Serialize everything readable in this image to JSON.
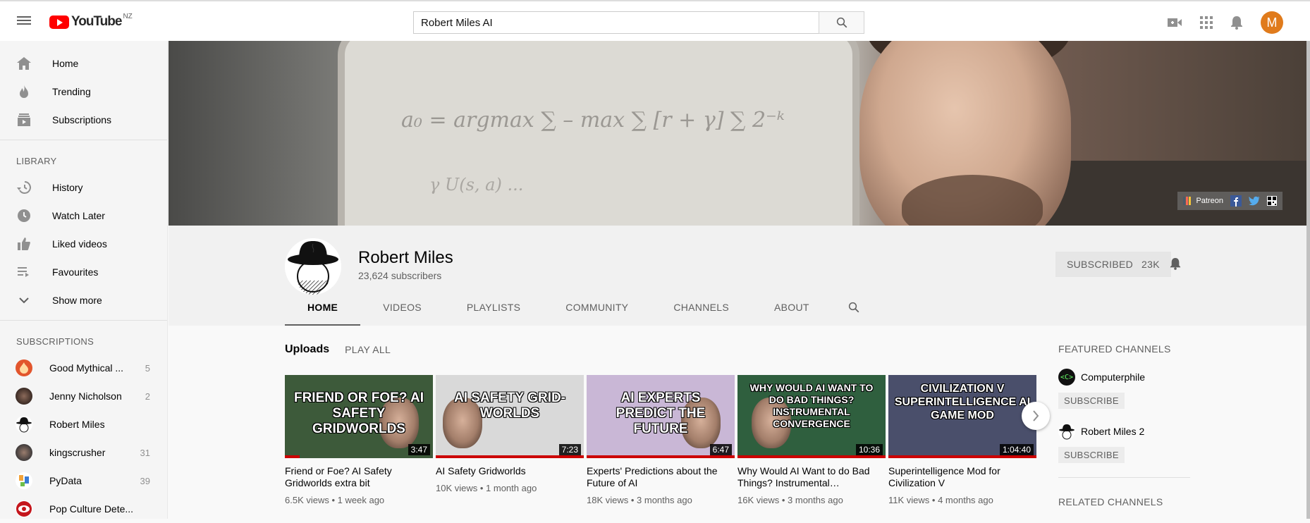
{
  "header": {
    "logo_text": "YouTube",
    "country_code": "NZ",
    "search_value": "Robert Miles AI",
    "avatar_letter": "M"
  },
  "sidebar": {
    "main": [
      {
        "label": "Home",
        "icon": "home-icon"
      },
      {
        "label": "Trending",
        "icon": "trending-icon"
      },
      {
        "label": "Subscriptions",
        "icon": "subscriptions-icon"
      }
    ],
    "library_title": "LIBRARY",
    "library": [
      {
        "label": "History",
        "icon": "history-icon"
      },
      {
        "label": "Watch Later",
        "icon": "clock-icon"
      },
      {
        "label": "Liked videos",
        "icon": "thumbs-up-icon"
      },
      {
        "label": "Favourites",
        "icon": "playlist-icon"
      },
      {
        "label": "Show more",
        "icon": "chevron-down-icon"
      }
    ],
    "subscriptions_title": "SUBSCRIPTIONS",
    "subscriptions": [
      {
        "name": "Good Mythical ...",
        "count": "5"
      },
      {
        "name": "Jenny Nicholson",
        "count": "2"
      },
      {
        "name": "Robert Miles",
        "count": ""
      },
      {
        "name": "kingscrusher",
        "count": "31"
      },
      {
        "name": "PyData",
        "count": "39"
      },
      {
        "name": "Pop Culture Dete...",
        "count": ""
      }
    ]
  },
  "banner": {
    "equation": "a₀ = argmax ∑ – max ∑ [r + γ] ∑ 2⁻ᵏ",
    "equation2": "γ U(s, a) ...",
    "links": {
      "patreon": "Patreon"
    }
  },
  "channel": {
    "name": "Robert Miles",
    "subscribers": "23,624 subscribers",
    "subscribed_label": "SUBSCRIBED",
    "subscribed_count": "23K",
    "tabs": [
      "HOME",
      "VIDEOS",
      "PLAYLISTS",
      "COMMUNITY",
      "CHANNELS",
      "ABOUT"
    ]
  },
  "uploads": {
    "title": "Uploads",
    "play_all": "PLAY ALL",
    "videos": [
      {
        "thumb_text": "FRIEND OR FOE? AI SAFETY GRIDWORLDS",
        "duration": "3:47",
        "title": "Friend or Foe? AI Safety Gridworlds extra bit",
        "views": "6.5K views",
        "age": "1 week ago",
        "progress": 0.1,
        "bg": "#3d5a3a"
      },
      {
        "thumb_text": "AI SAFETY GRID-WORLDS",
        "duration": "7:23",
        "title": "AI Safety Gridworlds",
        "views": "10K views",
        "age": "1 month ago",
        "progress": 1.0,
        "bg": "#d9d9d9"
      },
      {
        "thumb_text": "AI EXPERTS PREDICT THE FUTURE",
        "duration": "6:47",
        "title": "Experts' Predictions about the Future of AI",
        "views": "18K views",
        "age": "3 months ago",
        "progress": 1.0,
        "bg": "#c9b7d6"
      },
      {
        "thumb_text": "WHY WOULD AI WANT TO DO BAD THINGS? INSTRUMENTAL CONVERGENCE",
        "duration": "10:36",
        "title": "Why Would AI Want to do Bad Things? Instrumental…",
        "views": "16K views",
        "age": "3 months ago",
        "progress": 1.0,
        "bg": "#2f5f3e"
      },
      {
        "thumb_text": "CIVILIZATION V SUPERINTELLIGENCE AI GAME MOD",
        "duration": "1:04:40",
        "title": "Superintelligence Mod for Civilization V",
        "views": "11K views",
        "age": "4 months ago",
        "progress": 1.0,
        "bg": "#4a4f6b"
      }
    ]
  },
  "featured": {
    "title": "FEATURED CHANNELS",
    "channels": [
      {
        "name": "Computerphile",
        "button": "SUBSCRIBE"
      },
      {
        "name": "Robert Miles 2",
        "button": "SUBSCRIBE"
      }
    ],
    "related_title": "RELATED CHANNELS"
  },
  "colors": {
    "brand": "#ff0000",
    "accent": "#cc0000",
    "avatar": "#e07b1c"
  }
}
